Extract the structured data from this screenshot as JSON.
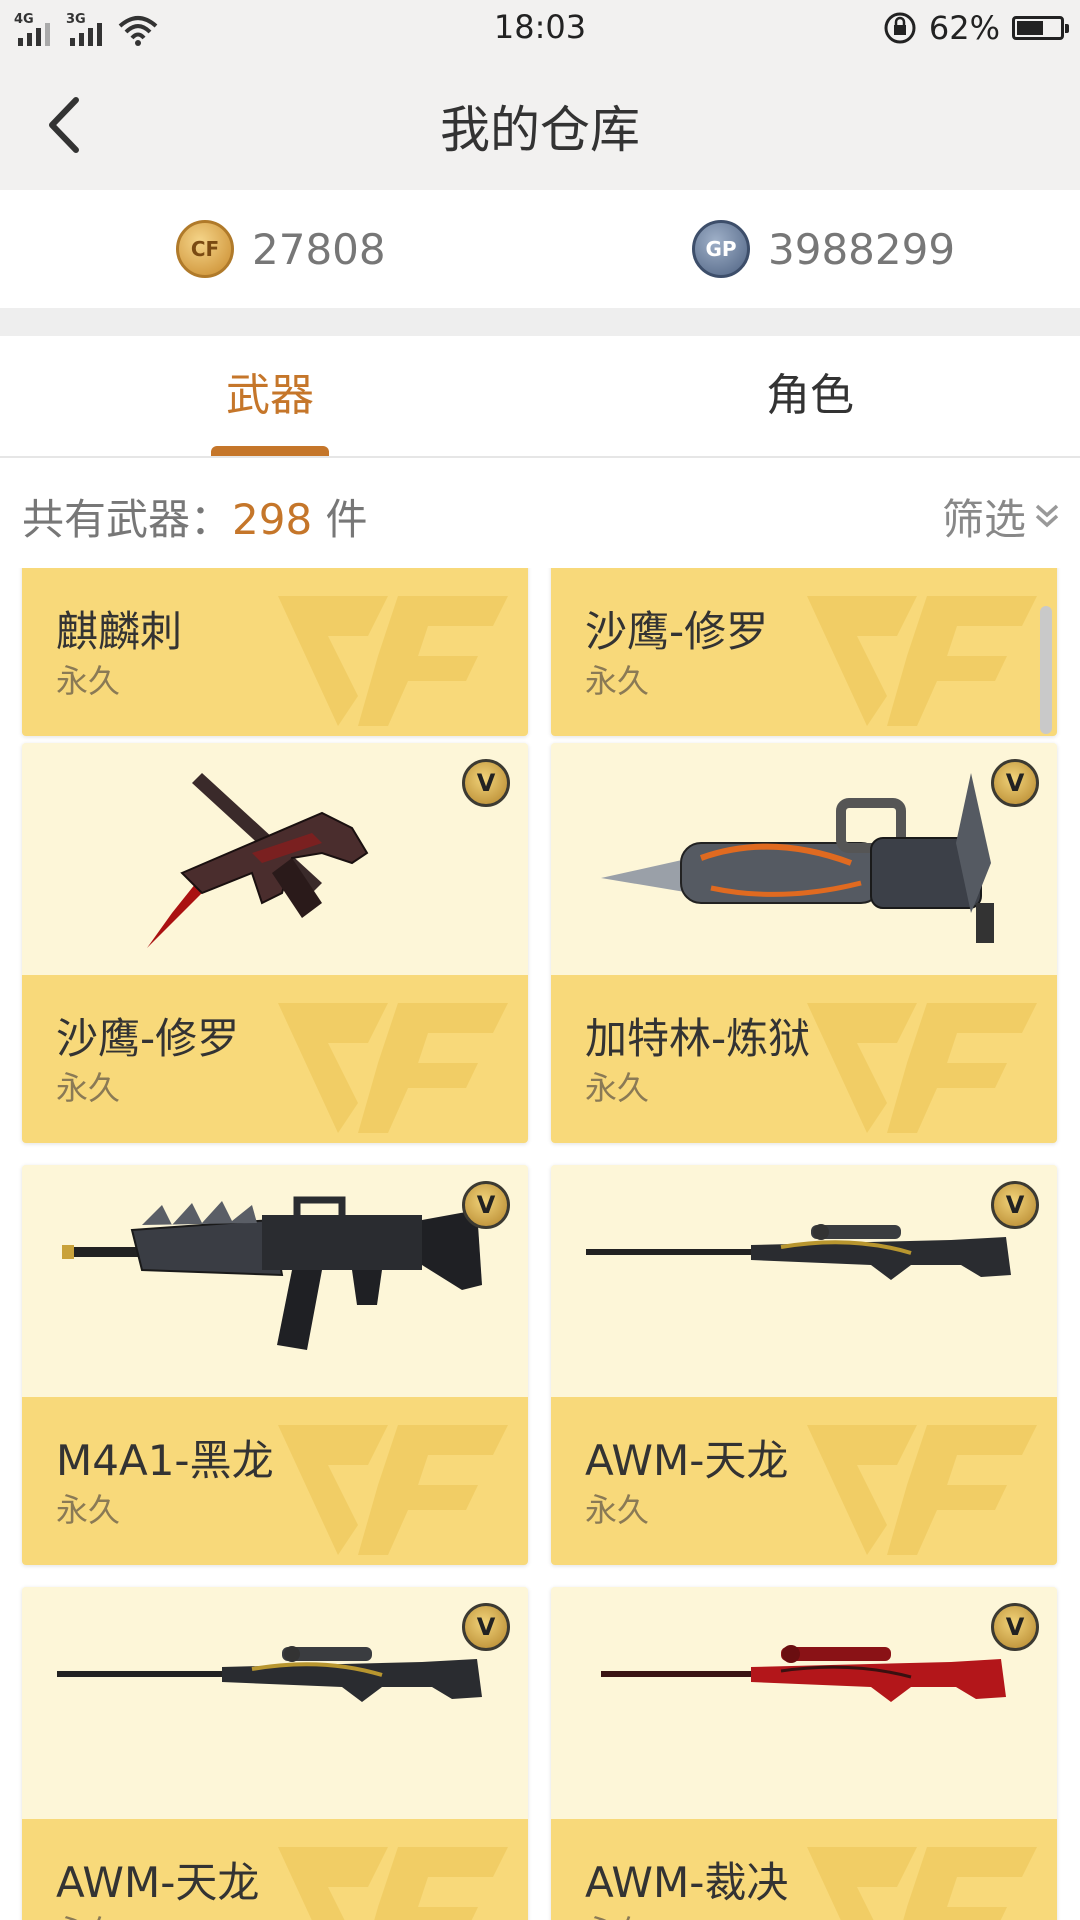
{
  "status_bar": {
    "net1": "4G",
    "net2": "3G",
    "time": "18:03",
    "battery_text": "62%",
    "battery_level": 0.62
  },
  "nav": {
    "title": "我的仓库"
  },
  "currency": {
    "cf_amount": "27808",
    "cf_icon_label": "CF",
    "gp_amount": "3988299",
    "gp_icon_label": "GP"
  },
  "tabs": {
    "weapons": "武器",
    "characters": "角色"
  },
  "count": {
    "label": "共有武器：",
    "value": "298",
    "unit": " 件"
  },
  "filter": {
    "label": "筛选"
  },
  "badge_label": "V",
  "accent_color": "#c5762a",
  "items": [
    {
      "name": "麒麟刺",
      "duration": "永久",
      "badge": false,
      "icon": "knife-icon"
    },
    {
      "name": "沙鹰-修罗",
      "duration": "永久",
      "badge": false,
      "icon": "pistol-icon"
    },
    {
      "name": "沙鹰-修罗",
      "duration": "永久",
      "badge": true,
      "icon": "pistol-blade-icon"
    },
    {
      "name": "加特林-炼狱",
      "duration": "永久",
      "badge": true,
      "icon": "gatling-icon"
    },
    {
      "name": "M4A1-黑龙",
      "duration": "永久",
      "badge": true,
      "icon": "rifle-icon"
    },
    {
      "name": "AWM-天龙",
      "duration": "永久",
      "badge": true,
      "icon": "sniper-icon"
    },
    {
      "name": "AWM-天龙",
      "duration": "永久",
      "badge": true,
      "icon": "sniper-icon"
    },
    {
      "name": "AWM-裁决",
      "duration": "永久",
      "badge": true,
      "icon": "sniper-red-icon"
    }
  ]
}
